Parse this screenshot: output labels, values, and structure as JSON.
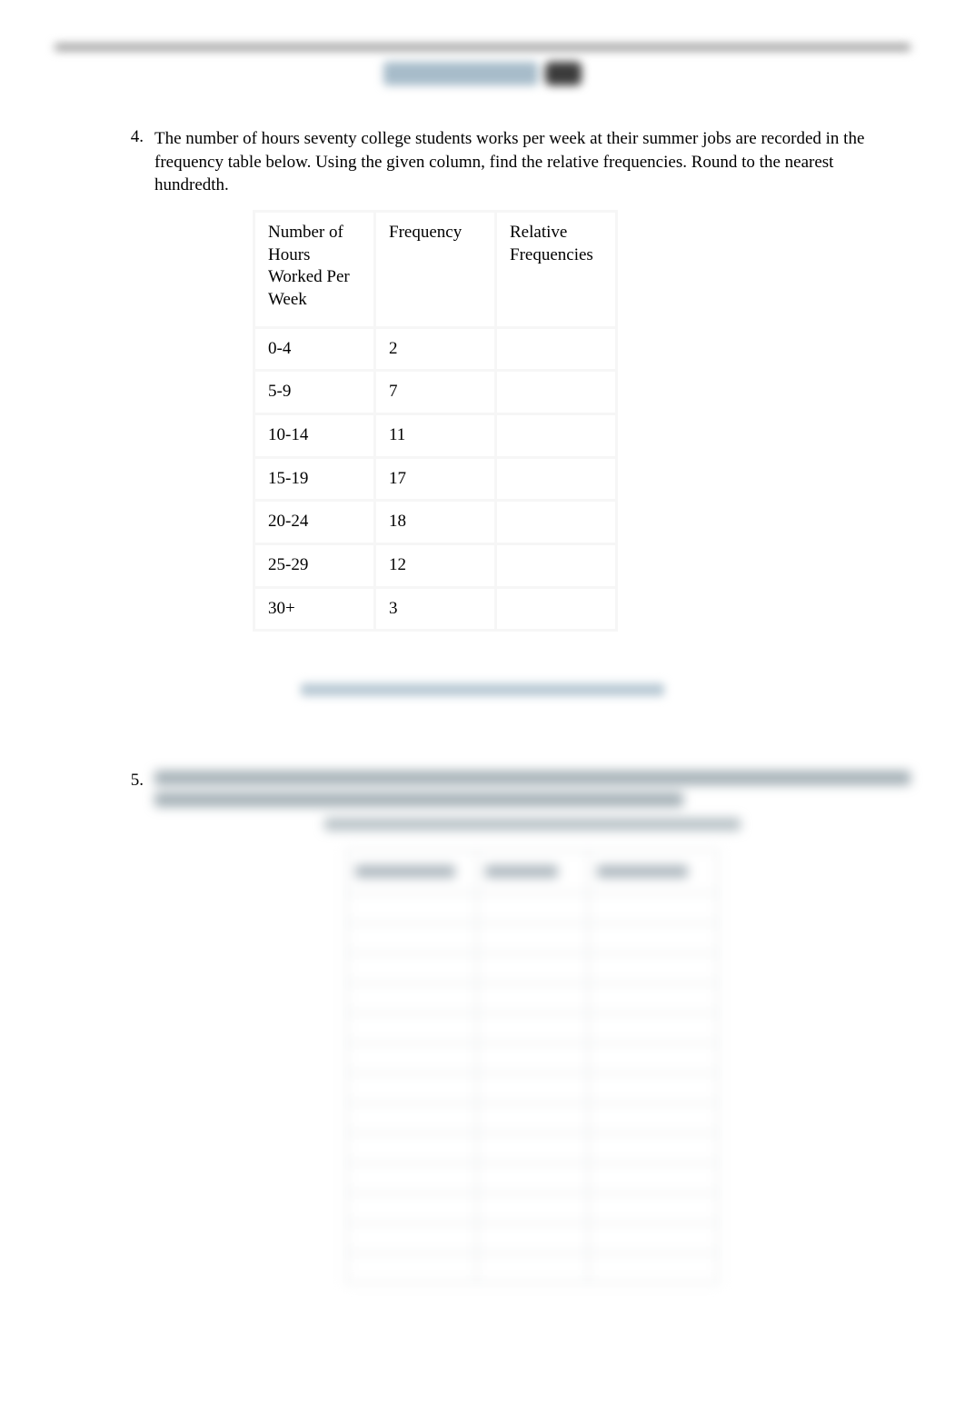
{
  "question4": {
    "number": "4.",
    "prompt": "The number of hours seventy college students works per week at their summer jobs are recorded in the frequency table below. Using the given column, find the relative frequencies. Round to the nearest hundredth.",
    "table": {
      "headers": {
        "hours": "Number of Hours Worked Per Week",
        "frequency": "Frequency",
        "relative": "Relative Frequencies"
      },
      "rows": [
        {
          "hours": "0-4",
          "frequency": "2",
          "relative": ""
        },
        {
          "hours": "5-9",
          "frequency": "7",
          "relative": ""
        },
        {
          "hours": "10-14",
          "frequency": "11",
          "relative": ""
        },
        {
          "hours": "15-19",
          "frequency": "17",
          "relative": ""
        },
        {
          "hours": "20-24",
          "frequency": "18",
          "relative": ""
        },
        {
          "hours": "25-29",
          "frequency": "12",
          "relative": ""
        },
        {
          "hours": "30+",
          "frequency": "3",
          "relative": ""
        }
      ]
    }
  },
  "question5": {
    "number": "5."
  }
}
